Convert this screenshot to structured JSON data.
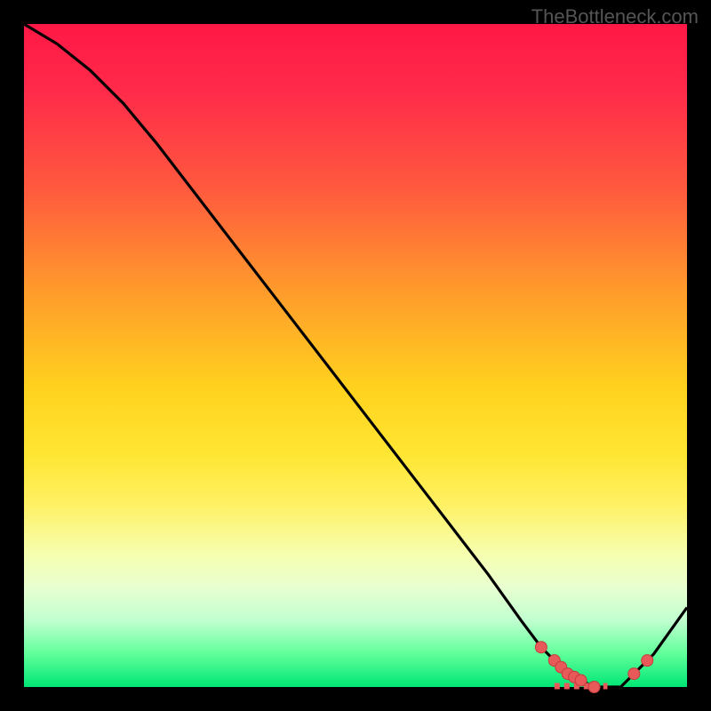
{
  "watermark": "TheBottleneck.com",
  "chart_data": {
    "type": "line",
    "title": "",
    "xlabel": "",
    "ylabel": "",
    "xlim": [
      0,
      1
    ],
    "ylim": [
      0,
      1
    ],
    "series": [
      {
        "name": "curve",
        "x": [
          0.0,
          0.05,
          0.1,
          0.15,
          0.2,
          0.3,
          0.4,
          0.5,
          0.6,
          0.7,
          0.75,
          0.78,
          0.82,
          0.86,
          0.9,
          0.95,
          1.0
        ],
        "y": [
          1.0,
          0.97,
          0.93,
          0.88,
          0.82,
          0.69,
          0.56,
          0.43,
          0.3,
          0.17,
          0.1,
          0.06,
          0.02,
          0.0,
          0.0,
          0.05,
          0.12
        ]
      }
    ],
    "markers": [
      {
        "x": 0.78,
        "y": 0.06
      },
      {
        "x": 0.8,
        "y": 0.04
      },
      {
        "x": 0.81,
        "y": 0.03
      },
      {
        "x": 0.82,
        "y": 0.02
      },
      {
        "x": 0.83,
        "y": 0.015
      },
      {
        "x": 0.84,
        "y": 0.01
      },
      {
        "x": 0.86,
        "y": 0.0
      },
      {
        "x": 0.92,
        "y": 0.02
      },
      {
        "x": 0.94,
        "y": 0.04
      }
    ],
    "dash_segment": {
      "x_start": 0.8,
      "x_end": 0.88,
      "y": 0.0
    }
  },
  "colors": {
    "curve": "#000000",
    "marker_fill": "#e85a5a",
    "marker_stroke": "#c43c3c",
    "dash": "#e85a5a"
  }
}
